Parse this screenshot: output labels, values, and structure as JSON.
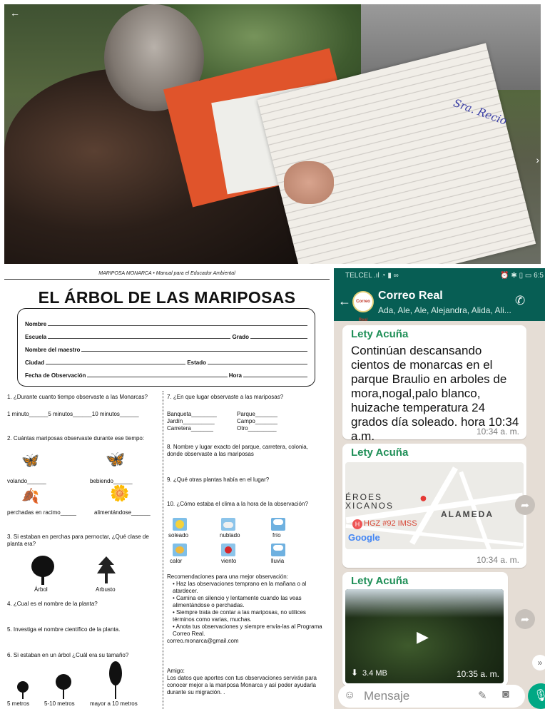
{
  "photo": {
    "letter_handwriting": "Sra. Recio"
  },
  "manual": {
    "header": "MARIPOSA MONARCA • Manual para el Educador Ambiental",
    "title": "EL ÁRBOL DE LAS MARIPOSAS",
    "form": {
      "nombre": "Nombre",
      "escuela": "Escuela",
      "grado": "Grado",
      "maestro": "Nombre del maestro",
      "ciudad": "Ciudad",
      "estado": "Estado",
      "fecha": "Fecha de Observación",
      "hora": "Hora"
    },
    "left": {
      "q1": "1. ¿Durante cuanto tiempo observaste a las Monarcas?",
      "q1_opts": "1 minuto______5 minutos______10 minutos______",
      "q2": "2.  Cuántas mariposas observaste durante ese tiempo:",
      "volando": "volando______",
      "bebiendo": "bebiendo______",
      "percha": "perchadas en racimo_____",
      "alimentandose": "alimentándose______",
      "q3": "3. Si estaban  en  perchas para pernoctar, ¿Qué clase de planta era?",
      "arbol": "Árbol",
      "arbusto": "Arbusto",
      "q4": "4. ¿Cual es el nombre de la planta?",
      "q5": "5. Investiga el nombre científico de la planta.",
      "q6": "6. Si estaban en un árbol ¿Cuál era su tamaño?",
      "size1": "5 metros",
      "size2": "5-10 metros",
      "size3": "mayor a 10 metros"
    },
    "right": {
      "q7": "7. ¿En que lugar observaste a las mariposas?",
      "banqueta": "Banqueta________",
      "jardin": "Jardín__________",
      "carretera": "Carretera_______",
      "parque": "Parque_______",
      "campo": "Campo_______",
      "otro": "Otro_________",
      "q8": "8. Nombre y lugar exacto del parque, carretera, colonia, donde observaste a las mariposas",
      "q9": "9. ¿Qué  otras plantas había en el lugar?",
      "q10": "10. ¿Cómo estaba el clima a la hora de la observación?",
      "soleado": "soleado",
      "nublado": "nublado",
      "frio": "frío",
      "calor": "calor",
      "viento": "viento",
      "lluvia": "lluvia",
      "rec_title": "Recomendaciones para una mejor observación:",
      "rec1": "• Haz las observaciones temprano en la mañana o al atardecer.",
      "rec2": "• Camina en silencio y lentamente cuando las veas alimentándose o perchadas.",
      "rec3": "• Siempre trata de contar a las mariposas, no utilices términos como varias, muchas.",
      "rec4": "• Anota tus observaciones y siempre envía-las al Programa Correo Real.",
      "email": "correo.monarca@gmail.com",
      "amigo": "Amigo:",
      "amigo_text": "Los datos que aportes con tus observaciones servirán para conocer mejor a la mariposa Monarca y así poder ayudarla durante su migración.  ."
    }
  },
  "whatsapp": {
    "status_carrier": "TELCEL",
    "status_time": "6:5",
    "chat_name": "Correo Real",
    "avatar_text": "Correo Real",
    "members": "Ada, Ale, Ale, Alejandra, Alida, Ali...",
    "messages": [
      {
        "sender": "Lety Acuña",
        "text": "Continúan descansando cientos de  monarcas en el parque Braulio en arboles de mora,nogal,palo blanco, huizache temperatura 24 grados día soleado.  hora 10:34 a.m.",
        "time": "10:34 a. m."
      },
      {
        "sender": "Lety Acuña",
        "map_labels": [
          "ÉROES",
          "XICANOS",
          "ALAMEDA",
          "HGZ #92 IMSS",
          "Google"
        ],
        "time": "10:34 a. m."
      },
      {
        "sender": "Lety Acuña",
        "video_size": "3.4 MB",
        "time": "10:35 a. m."
      }
    ],
    "input_placeholder": "Mensaje"
  },
  "colors": {
    "wa_header": "#075e54",
    "wa_sender": "#1f8f57",
    "wa_bg": "#e5ddd5",
    "wa_mic": "#00a884"
  }
}
